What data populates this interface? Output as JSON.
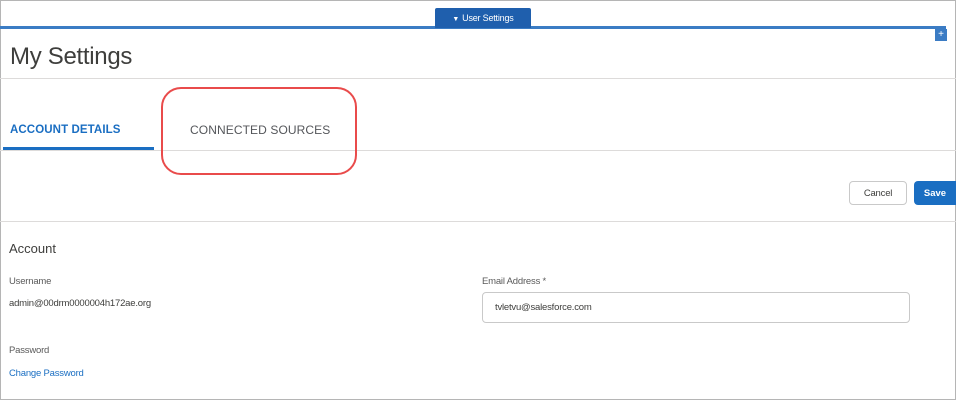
{
  "header": {
    "pill_label": "User Settings",
    "pill_icon": "chevron-down-icon",
    "corner_button_label": "+"
  },
  "page": {
    "title": "My Settings"
  },
  "tabs": [
    {
      "label": "ACCOUNT DETAILS",
      "active": true
    },
    {
      "label": "CONNECTED SOURCES",
      "active": false
    }
  ],
  "annotation": {
    "color": "#e94b4b",
    "target": "CONNECTED SOURCES"
  },
  "actions": {
    "cancel_label": "Cancel",
    "save_label": "Save"
  },
  "account": {
    "section_title": "Account",
    "username_label": "Username",
    "username_value": "admin@00drm0000004h172ae.org",
    "password_label": "Password",
    "change_password_link": "Change Password",
    "email_label": "Email Address *",
    "email_value": "tvletvu@salesforce.com"
  },
  "colors": {
    "accent": "#1a6ec2",
    "header_blue": "#1f5fad",
    "highlight": "#e94b4b"
  }
}
